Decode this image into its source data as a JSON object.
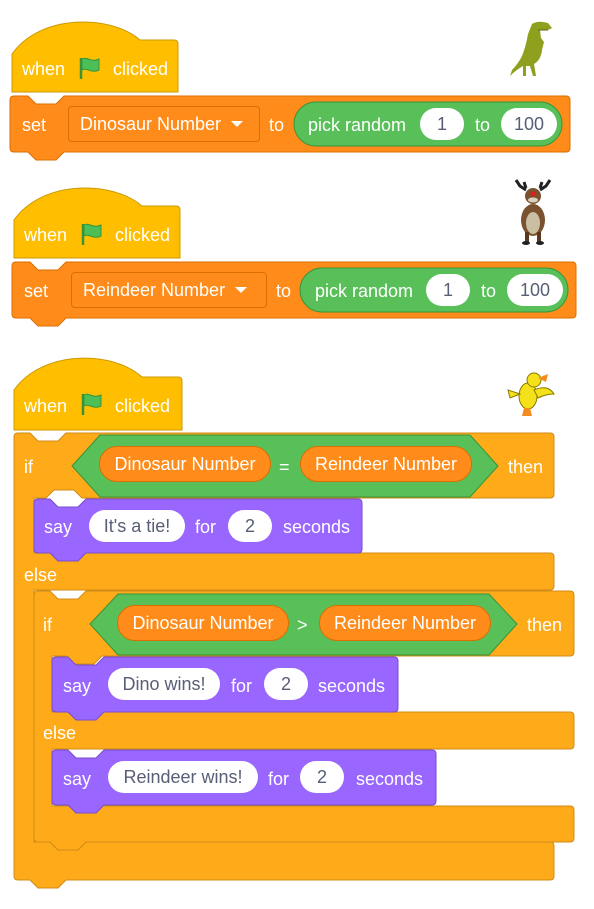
{
  "colors": {
    "events": "#ffbf00",
    "variables": "#ff8c1a",
    "operators": "#59c059",
    "control": "#ffab19",
    "looks": "#9966ff",
    "input_text": "#575e75"
  },
  "scripts": [
    {
      "sprite": "dinosaur",
      "hat": {
        "when": "when",
        "icon": "green-flag-icon",
        "clicked": "clicked"
      },
      "set": {
        "label": "set",
        "variable": "Dinosaur Number",
        "to": "to",
        "reporter": {
          "label": "pick random",
          "from": "1",
          "to_label": "to",
          "to": "100"
        }
      }
    },
    {
      "sprite": "reindeer",
      "hat": {
        "when": "when",
        "icon": "green-flag-icon",
        "clicked": "clicked"
      },
      "set": {
        "label": "set",
        "variable": "Reindeer Number",
        "to": "to",
        "reporter": {
          "label": "pick random",
          "from": "1",
          "to_label": "to",
          "to": "100"
        }
      }
    },
    {
      "sprite": "duck",
      "hat": {
        "when": "when",
        "icon": "green-flag-icon",
        "clicked": "clicked"
      },
      "if1": {
        "if": "if",
        "left": "Dinosaur Number",
        "op": "=",
        "right": "Reindeer Number",
        "then": "then",
        "say": {
          "say": "say",
          "message": "It's a tie!",
          "for": "for",
          "secs": "2",
          "seconds": "seconds"
        },
        "else": "else"
      },
      "if2": {
        "if": "if",
        "left": "Dinosaur Number",
        "op": ">",
        "right": "Reindeer Number",
        "then": "then",
        "say": {
          "say": "say",
          "message": "Dino wins!",
          "for": "for",
          "secs": "2",
          "seconds": "seconds"
        },
        "else": "else",
        "say_else": {
          "say": "say",
          "message": "Reindeer wins!",
          "for": "for",
          "secs": "2",
          "seconds": "seconds"
        }
      }
    }
  ]
}
